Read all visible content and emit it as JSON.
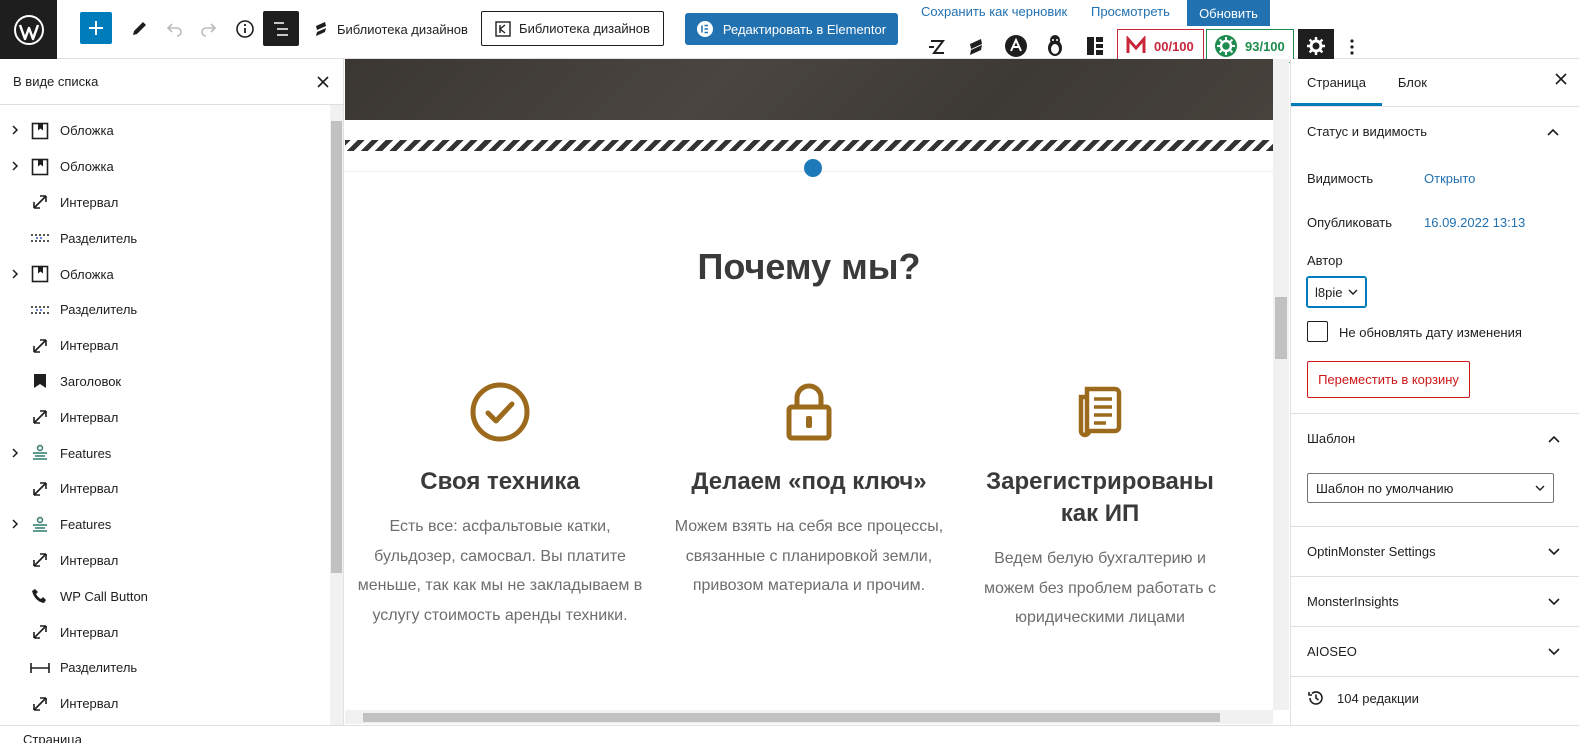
{
  "toolbar": {
    "library_label_1": "Библиотека дизайнов",
    "library_label_2": "Библиотека дизайнов",
    "elementor_label": "Редактировать в Elementor",
    "save_draft": "Сохранить как черновик",
    "preview": "Просмотреть",
    "update": "Обновить",
    "score_red": "00/100",
    "score_green": "93/100"
  },
  "list_view": {
    "title": "В виде списка",
    "items": [
      {
        "label": "Обложка",
        "icon": "cover-icon",
        "expandable": true
      },
      {
        "label": "Обложка",
        "icon": "cover-icon",
        "expandable": true
      },
      {
        "label": "Интервал",
        "icon": "spacer-icon",
        "expandable": false
      },
      {
        "label": "Разделитель",
        "icon": "separator-dots-icon",
        "expandable": false
      },
      {
        "label": "Обложка",
        "icon": "cover-icon",
        "expandable": true
      },
      {
        "label": "Разделитель",
        "icon": "separator-dots-icon",
        "expandable": false
      },
      {
        "label": "Интервал",
        "icon": "spacer-icon",
        "expandable": false
      },
      {
        "label": "Заголовок",
        "icon": "bookmark-icon",
        "expandable": false
      },
      {
        "label": "Интервал",
        "icon": "spacer-icon",
        "expandable": false
      },
      {
        "label": "Features",
        "icon": "features-icon",
        "expandable": true
      },
      {
        "label": "Интервал",
        "icon": "spacer-icon",
        "expandable": false
      },
      {
        "label": "Features",
        "icon": "features-icon",
        "expandable": true
      },
      {
        "label": "Интервал",
        "icon": "spacer-icon",
        "expandable": false
      },
      {
        "label": "WP Call Button",
        "icon": "phone-icon",
        "expandable": false
      },
      {
        "label": "Интервал",
        "icon": "spacer-icon",
        "expandable": false
      },
      {
        "label": "Разделитель",
        "icon": "separator-line-icon",
        "expandable": false
      },
      {
        "label": "Интервал",
        "icon": "spacer-icon",
        "expandable": false
      }
    ]
  },
  "canvas": {
    "heading": "Почему мы?",
    "features": [
      {
        "icon": "check-circle-icon",
        "title": "Своя техника",
        "text": "Есть все: асфальтовые катки, бульдозер, самосвал. Вы платите меньше, так как мы не закладываем в услугу стоимость аренды техники."
      },
      {
        "icon": "lock-icon",
        "title": "Делаем «под ключ»",
        "text": "Можем взять на себя все процессы, связанные с планировкой земли, привозом материала и прочим."
      },
      {
        "icon": "document-icon",
        "title": "Зарегистрированы как ИП",
        "text": "Ведем белую бухгалтерию и можем без проблем работать с юридическими лицами"
      }
    ],
    "accent_color": "#9b6a1c"
  },
  "settings": {
    "tab_page": "Страница",
    "tab_block": "Блок",
    "status_title": "Статус и видимость",
    "visibility_label": "Видимость",
    "visibility_value": "Открыто",
    "publish_label": "Опубликовать",
    "publish_value": "16.09.2022 13:13",
    "author_label": "Автор",
    "author_value": "l8pie",
    "no_update_date": "Не обновлять дату изменения",
    "trash": "Переместить в корзину",
    "template_title": "Шаблон",
    "template_value": "Шаблон по умолчанию",
    "optin": "OptinMonster Settings",
    "monster": "MonsterInsights",
    "aioseo": "AIOSEO",
    "revisions": "104 редакции"
  },
  "footer": {
    "breadcrumb": "Страница"
  }
}
